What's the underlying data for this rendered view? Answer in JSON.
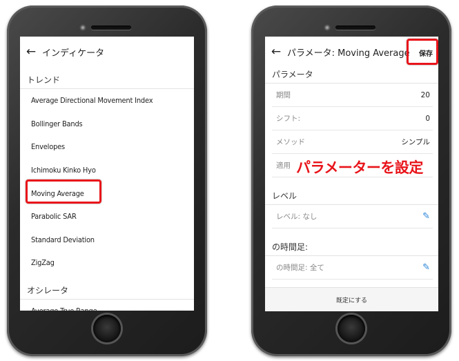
{
  "left_screen": {
    "back_icon": "arrow-left-icon",
    "title": "インディケータ",
    "sections": [
      {
        "heading": "トレンド",
        "items": [
          "Average Directional Movement Index",
          "Bollinger Bands",
          "Envelopes",
          "Ichimoku Kinko Hyo",
          "Moving Average",
          "Parabolic SAR",
          "Standard Deviation",
          "ZigZag"
        ]
      },
      {
        "heading": "オシレータ",
        "items": [
          "Average True Range"
        ]
      }
    ]
  },
  "right_screen": {
    "back_icon": "arrow-left-icon",
    "title": "パラメータ: Moving Average",
    "save_label": "保存",
    "params_heading": "パラメータ",
    "params": [
      {
        "label": "期間",
        "value": "20"
      },
      {
        "label": "シフト:",
        "value": "0"
      },
      {
        "label": "メソッド",
        "value": "シンプル"
      },
      {
        "label": "適用",
        "value": ""
      }
    ],
    "levels_heading": "レベル",
    "level_row_label": "レベル: なし",
    "timeframe_heading": "の時間足:",
    "timeframe_row_label": "の時間足: 全て",
    "footer_label": "既定にする",
    "overlay_text": "パラメーターを設定"
  },
  "colors": {
    "highlight": "#e8141a",
    "pencil": "#2a86d8"
  }
}
